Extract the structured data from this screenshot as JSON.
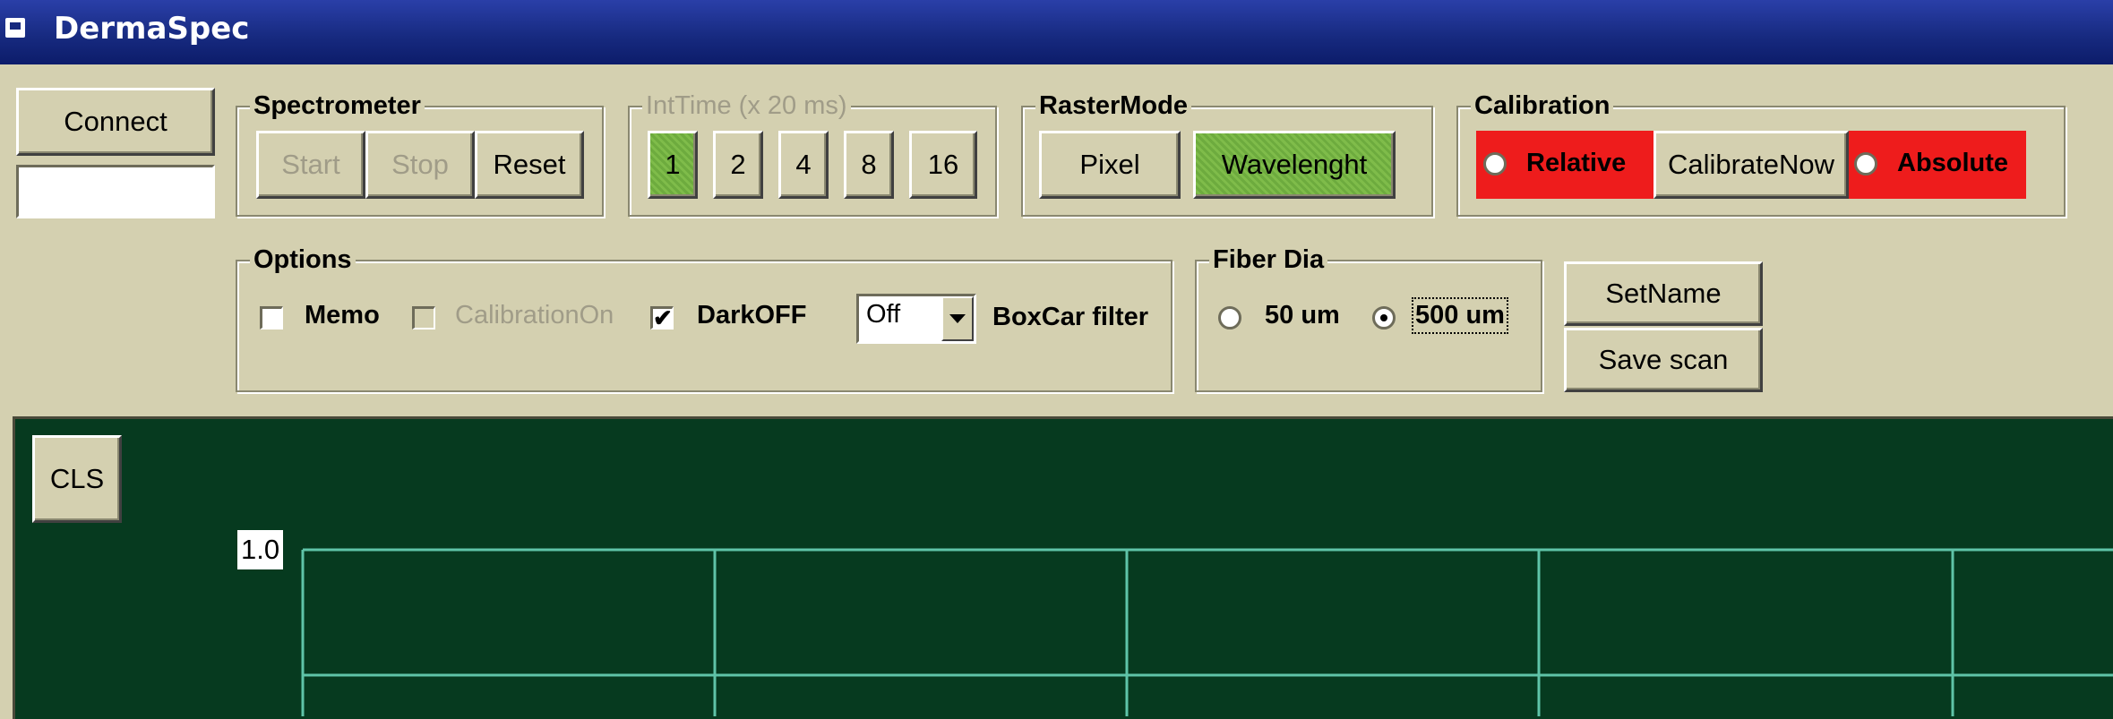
{
  "window": {
    "title": "DermaSpec"
  },
  "connect": {
    "label": "Connect",
    "status_value": ""
  },
  "spectrometer": {
    "legend": "Spectrometer",
    "start_label": "Start",
    "stop_label": "Stop",
    "reset_label": "Reset"
  },
  "inttime": {
    "legend": "IntTime (x 20 ms)",
    "options": [
      "1",
      "2",
      "4",
      "8",
      "16"
    ],
    "selected": "1"
  },
  "rastermode": {
    "legend": "RasterMode",
    "pixel_label": "Pixel",
    "wavelength_label": "Wavelenght",
    "selected": "Wavelenght"
  },
  "calibration": {
    "legend": "Calibration",
    "relative_label": "Relative",
    "calibrate_now_label": "CalibrateNow",
    "absolute_label": "Absolute",
    "highlight_color": "#ee1c1c"
  },
  "options": {
    "legend": "Options",
    "memo_label": "Memo",
    "memo_checked": false,
    "calibration_on_label": "CalibrationOn",
    "calibration_on_checked": false,
    "dark_off_label": "DarkOFF",
    "dark_off_checked": true,
    "checkmark": "✔",
    "boxcar_value": "Off",
    "boxcar_label": "BoxCar filter"
  },
  "fiber": {
    "legend": "Fiber Dia",
    "option_50_label": "50 um",
    "option_500_label": "500 um",
    "selected": "500 um"
  },
  "actions": {
    "set_name_label": "SetName",
    "save_scan_label": "Save scan"
  },
  "plot": {
    "cls_label": "CLS",
    "y_top_label": "1.0",
    "background_color": "#063a1f",
    "grid_color": "#5fc4a8"
  }
}
